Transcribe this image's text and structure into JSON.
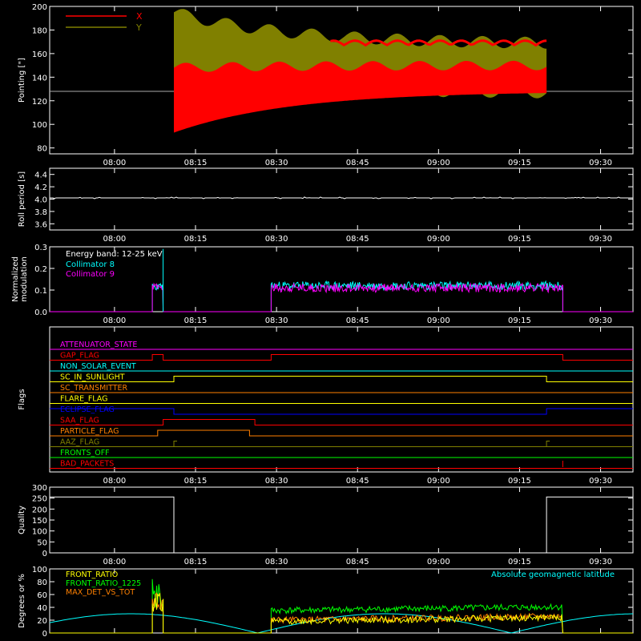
{
  "time_ticks": [
    "08:00",
    "08:15",
    "08:30",
    "08:45",
    "09:00",
    "09:15",
    "09:30"
  ],
  "chart_data": [
    {
      "type": "line",
      "id": "pointing",
      "ylabel": "Pointing [\"]",
      "ylim": [
        75,
        200
      ],
      "yticks": [
        80,
        100,
        120,
        140,
        160,
        180,
        200
      ],
      "series": [
        {
          "name": "X",
          "color": "#ff0000",
          "envelope": {
            "pre": 128,
            "post": 128,
            "start_min": 93,
            "start_max": 150,
            "end_min": 130,
            "end_max": 165
          }
        },
        {
          "name": "Y",
          "color": "#808000",
          "envelope": {
            "pre": 128,
            "post": 128,
            "start_min": 125,
            "start_max": 195,
            "end_min": 128,
            "end_max": 170
          }
        }
      ]
    },
    {
      "type": "line",
      "id": "roll",
      "ylabel": "Roll period [s]",
      "ylim": [
        3.5,
        4.5
      ],
      "yticks": [
        3.6,
        3.8,
        4.0,
        4.2,
        4.4
      ],
      "series": [
        {
          "name": "",
          "color": "#ffffff",
          "value": 4.02
        }
      ]
    },
    {
      "type": "line",
      "id": "modulation",
      "ylabel": [
        "Normalized",
        "modulation"
      ],
      "ylim": [
        0,
        0.3
      ],
      "yticks": [
        0.0,
        0.1,
        0.2,
        0.3
      ],
      "annotation": "Energy band: 12-25 keV",
      "series": [
        {
          "name": "Collimator 8",
          "color": "#00ffff",
          "active_level": 0.12,
          "spike": 0.29
        },
        {
          "name": "Collimator 9",
          "color": "#ff00ff",
          "active_level": 0.11,
          "spike": 0.14
        }
      ]
    },
    {
      "type": "line",
      "id": "flags",
      "ylabel": "Flags",
      "series": [
        {
          "name": "ATTENUATOR_STATE",
          "color": "#ff00ff",
          "segments": [
            [
              0
            ]
          ]
        },
        {
          "name": "GAP_FLAG",
          "color": "#ff0000",
          "segments": [
            [
              0,
              1,
              "08:07"
            ],
            [
              1,
              0,
              "08:09"
            ],
            [
              0,
              1,
              "08:29"
            ],
            [
              1,
              0,
              "09:23"
            ]
          ]
        },
        {
          "name": "NON_SOLAR_EVENT",
          "color": "#00ffff",
          "segments": [
            [
              0
            ]
          ]
        },
        {
          "name": "SC_IN_SUNLIGHT",
          "color": "#ffff00",
          "segments": [
            [
              0,
              1,
              "08:11"
            ],
            [
              1,
              0,
              "09:20"
            ]
          ]
        },
        {
          "name": "SC_TRANSMITTER",
          "color": "#ff8000",
          "segments": [
            [
              0
            ]
          ]
        },
        {
          "name": "FLARE_FLAG",
          "color": "#ffff00",
          "segments": [
            [
              0
            ]
          ]
        },
        {
          "name": "ECLIPSE_FLAG",
          "color": "#0000ff",
          "segments": [
            [
              1,
              0,
              "08:11"
            ],
            [
              0,
              1,
              "09:20"
            ]
          ]
        },
        {
          "name": "SAA_FLAG",
          "color": "#ff0000",
          "segments": [
            [
              0,
              1,
              "08:09"
            ],
            [
              1,
              0,
              "08:26"
            ]
          ]
        },
        {
          "name": "PARTICLE_FLAG",
          "color": "#ff8000",
          "segments": [
            [
              0,
              1,
              "08:08"
            ],
            [
              1,
              0,
              "08:25"
            ]
          ]
        },
        {
          "name": "AAZ_FLAG",
          "color": "#808000",
          "segments": [
            [
              0,
              1,
              "08:11"
            ],
            [
              1,
              0,
              "08:11"
            ],
            [
              0,
              1,
              "09:20"
            ],
            [
              1,
              0,
              "09:20"
            ]
          ]
        },
        {
          "name": "FRONTS_OFF",
          "color": "#00ff00",
          "segments": [
            [
              0
            ]
          ]
        },
        {
          "name": "BAD_PACKETS",
          "color": "#ff0000",
          "segments": [
            [
              0
            ]
          ]
        }
      ]
    },
    {
      "type": "line",
      "id": "quality",
      "ylabel": "Quality",
      "ylim": [
        0,
        300
      ],
      "yticks": [
        0,
        50,
        100,
        150,
        200,
        250,
        300
      ],
      "series": [
        {
          "name": "",
          "color": "#ffffff",
          "high": 255,
          "low": 0
        }
      ]
    },
    {
      "type": "line",
      "id": "latitude",
      "ylabel": "Degrees or %",
      "ylim": [
        0,
        100
      ],
      "yticks": [
        0,
        20,
        40,
        60,
        80,
        100
      ],
      "series": [
        {
          "name": "FRONT_RATIO",
          "color": "#ffff00",
          "level": 18
        },
        {
          "name": "FRONT_RATIO_1225",
          "color": "#00ff00",
          "level": 35
        },
        {
          "name": "MAX_DET_VS_TOT",
          "color": "#ff8000",
          "level": 20
        },
        {
          "name": "Absolute geomagnetic latitude",
          "color": "#00ffff",
          "level": 28
        }
      ]
    }
  ]
}
